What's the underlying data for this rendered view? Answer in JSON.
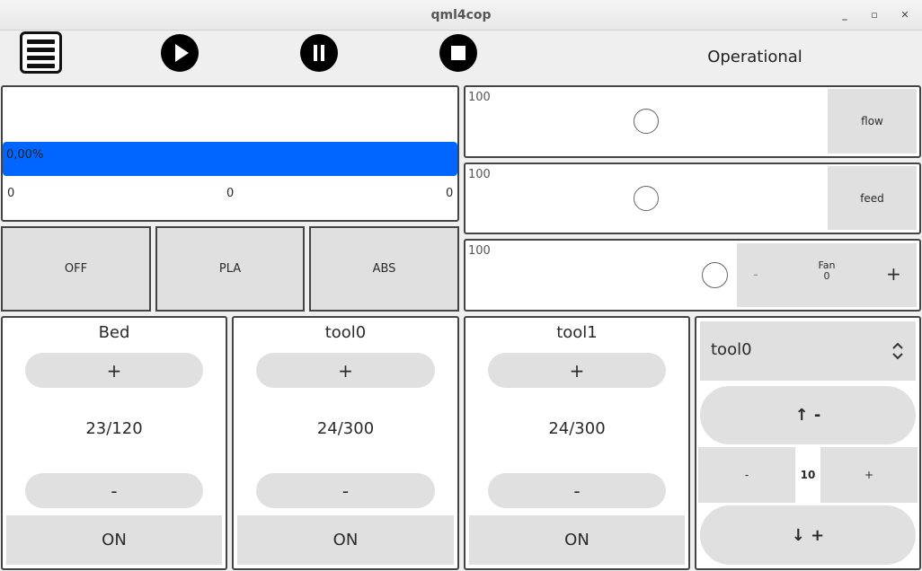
{
  "window": {
    "title": "qml4cop"
  },
  "toolbar": {
    "status": "Operational"
  },
  "progress": {
    "percent_label": "0,00%",
    "fraction": 0,
    "left": "0",
    "middle": "0",
    "right": "0"
  },
  "sliders": [
    {
      "value": "100",
      "button": "flow"
    },
    {
      "value": "100",
      "button": "feed"
    },
    {
      "value": "100"
    }
  ],
  "fan": {
    "label": "Fan",
    "value": "0",
    "minus": "-",
    "plus": "+"
  },
  "presets": [
    "OFF",
    "PLA",
    "ABS"
  ],
  "heaters": [
    {
      "name": "Bed",
      "plus": "+",
      "temp": "23/120",
      "minus": "-",
      "toggle": "ON"
    },
    {
      "name": "tool0",
      "plus": "+",
      "temp": "24/300",
      "minus": "-",
      "toggle": "ON"
    },
    {
      "name": "tool1",
      "plus": "+",
      "temp": "24/300",
      "minus": "-",
      "toggle": "ON"
    }
  ],
  "extruder": {
    "tool_select": "tool0",
    "retract_label": "↑ -",
    "step_minus": "-",
    "step_value": "10",
    "step_plus": "+",
    "extrude_label": "↓ +"
  }
}
